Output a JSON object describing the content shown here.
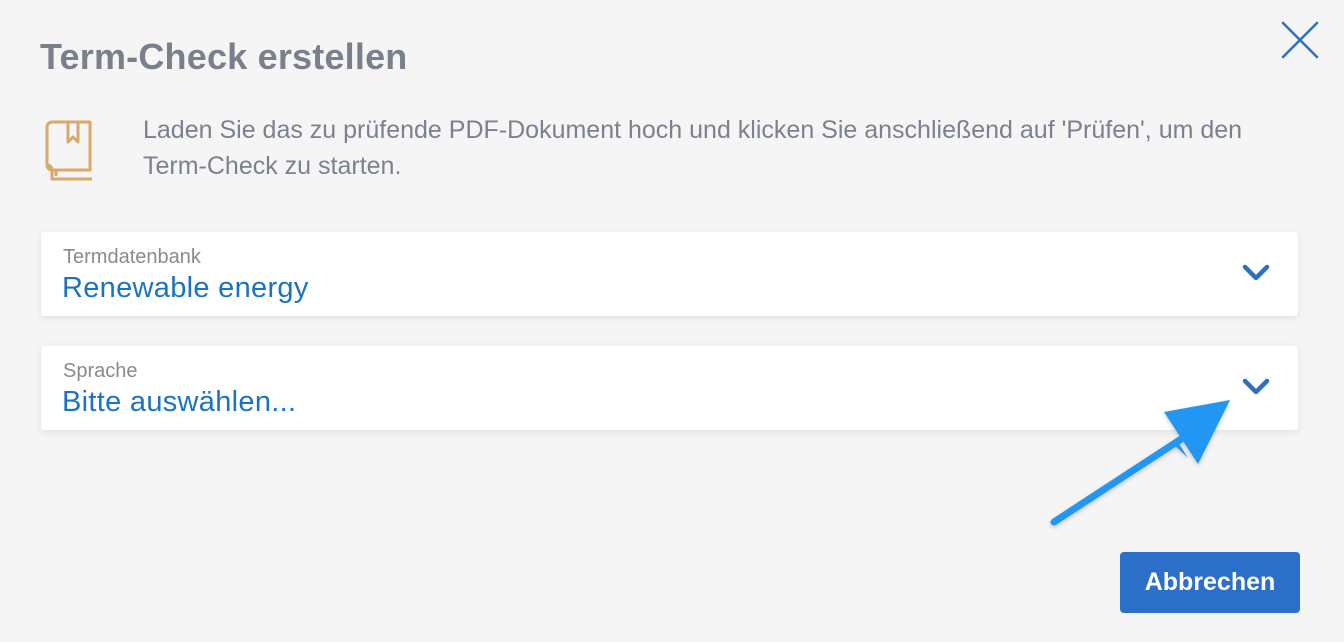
{
  "dialog": {
    "title": "Term-Check erstellen",
    "info_text": "Laden Sie das zu prüfende PDF-Dokument hoch und klicken Sie anschließend auf 'Prüfen', um den Term-Check zu starten."
  },
  "fields": {
    "termdatenbank": {
      "label": "Termdatenbank",
      "value": "Renewable energy"
    },
    "sprache": {
      "label": "Sprache",
      "value": "Bitte auswählen..."
    }
  },
  "buttons": {
    "cancel_label": "Abbrechen"
  },
  "icons": {
    "close": "close-icon",
    "book": "book-icon",
    "chevron": "chevron-down-icon",
    "annotation": "arrow-annotation"
  },
  "colors": {
    "accent": "#1a73c6",
    "button": "#2b6fc9",
    "title": "#7a7f8c",
    "book_icon": "#d9a86c",
    "annotation_arrow": "#2196f3",
    "background": "#f5f5f5"
  }
}
